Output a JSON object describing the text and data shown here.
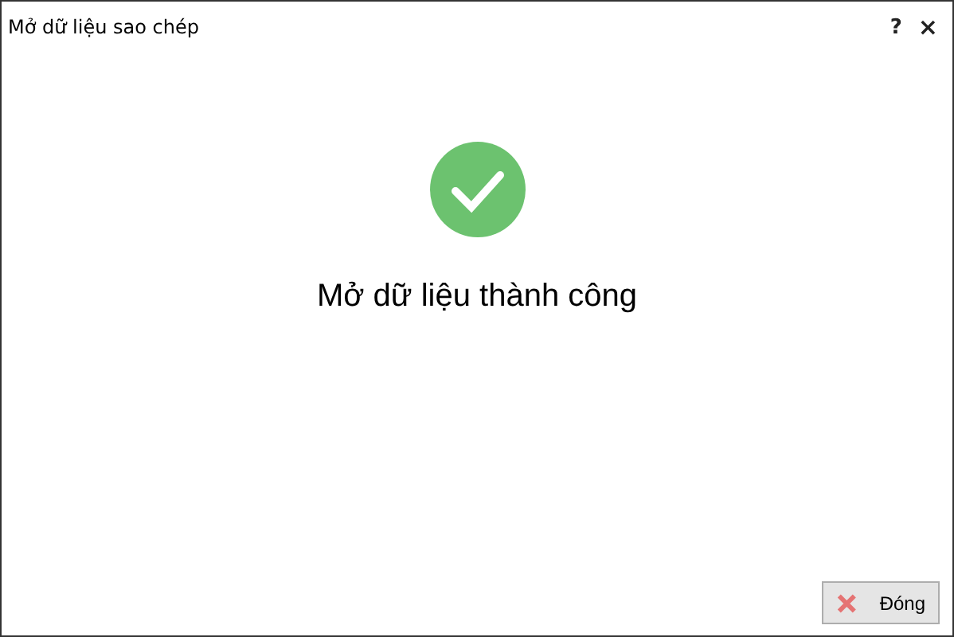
{
  "window": {
    "title": "Mở dữ liệu sao chép",
    "help": "?",
    "close": "×"
  },
  "message": "Mở dữ liệu thành công",
  "buttons": [
    {
      "label": "Đóng"
    }
  ]
}
